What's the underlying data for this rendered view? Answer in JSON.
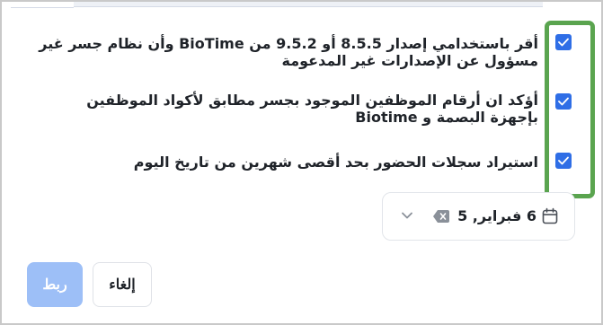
{
  "consents": [
    {
      "label": "أقر باستخدامي إصدار 8.5.5 أو 9.5.2 من BioTime وأن نظام جسر غير مسؤول عن الإصدارات غير المدعومة",
      "checked": true
    },
    {
      "label": "أؤكد ان أرقام الموظفين الموجود بجسر مطابق لأكواد الموظفين بإجهزة البصمة و Biotime",
      "checked": true
    },
    {
      "label": "استيراد سجلات الحضور بحد أقصى شهرين من تاريخ اليوم",
      "checked": true
    }
  ],
  "date_picker": {
    "value": "6 فبراير, 5",
    "icons": [
      "calendar-icon",
      "clear-icon",
      "chevron-down-icon"
    ]
  },
  "actions": {
    "cancel_label": "إلغاء",
    "link_label": "ربط"
  },
  "colors": {
    "checkbox": "#2f6ee6",
    "highlight": "#5aa44f",
    "primary_disabled": "#9dbff7"
  }
}
